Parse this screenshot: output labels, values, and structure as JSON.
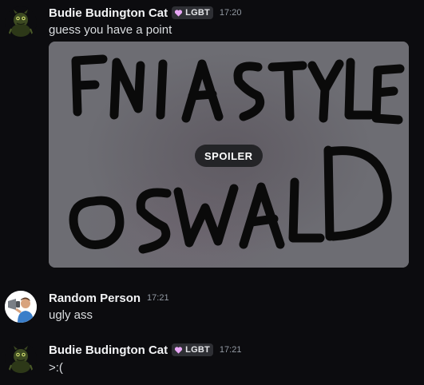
{
  "colors": {
    "background": "#0c0c0f",
    "author": "#f2f3f5",
    "text": "#dbdee1",
    "timestamp": "#949ba4",
    "tag_background": "#2e2f34",
    "tag_heart": "#e8a6f5",
    "spoiler_overlay": "#6d6d73"
  },
  "messages": [
    {
      "author": "Budie Budington Cat",
      "tag": "LGBT",
      "tag_icon": "heart-icon",
      "time": "17:20",
      "text": "guess you have a point",
      "avatar_icon": "green-creature-avatar",
      "attachment": {
        "type": "image",
        "spoiler_label": "SPOILER",
        "handwritten_text": "FNIA STYLE OSWALD"
      }
    },
    {
      "author": "Random Person",
      "time": "17:21",
      "text": "ugly ass",
      "avatar_icon": "person-with-megaphone-avatar"
    },
    {
      "author": "Budie Budington Cat",
      "tag": "LGBT",
      "tag_icon": "heart-icon",
      "time": "17:21",
      "text": ">:(",
      "avatar_icon": "green-creature-avatar"
    }
  ]
}
